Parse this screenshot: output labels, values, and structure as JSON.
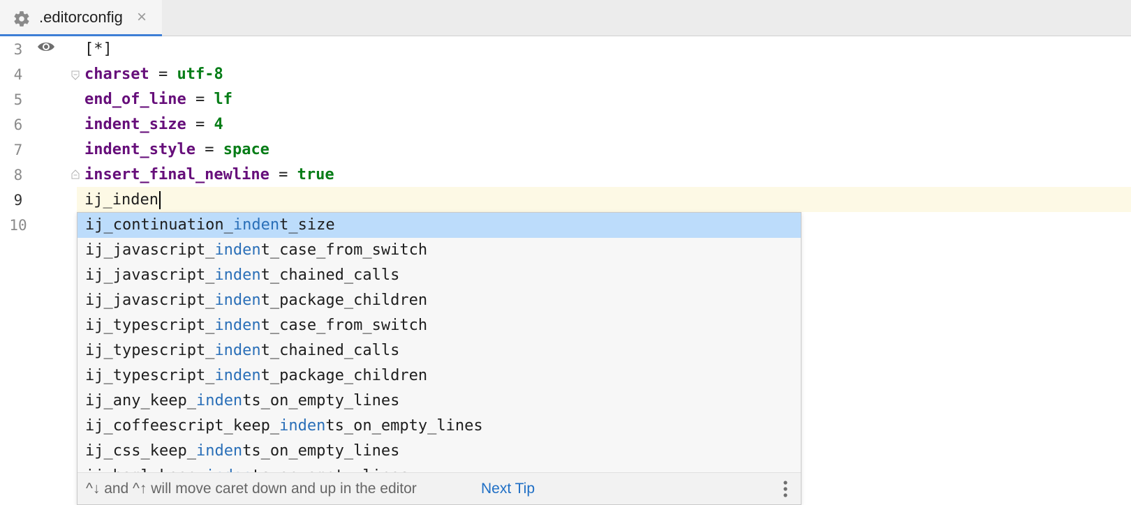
{
  "tab": {
    "title": ".editorconfig",
    "icon": "gear-icon",
    "close": "×"
  },
  "editor": {
    "lines": [
      {
        "num": "3",
        "plain": "[*]"
      },
      {
        "num": "4",
        "key": "charset",
        "sep": " = ",
        "value": "utf-8"
      },
      {
        "num": "5",
        "key": "end_of_line",
        "sep": " = ",
        "value": "lf"
      },
      {
        "num": "6",
        "key": "indent_size",
        "sep": " = ",
        "value": "4"
      },
      {
        "num": "7",
        "key": "indent_style",
        "sep": " = ",
        "value": "space"
      },
      {
        "num": "8",
        "key": "insert_final_newline",
        "sep": " = ",
        "value": "true"
      },
      {
        "num": "9",
        "plain": "ij_inden"
      },
      {
        "num": "10",
        "plain": ""
      }
    ]
  },
  "completion": {
    "items": [
      {
        "pre": "ij_continuation_",
        "match": "inden",
        "post": "t_size"
      },
      {
        "pre": "ij_javascript_",
        "match": "inden",
        "post": "t_case_from_switch"
      },
      {
        "pre": "ij_javascript_",
        "match": "inden",
        "post": "t_chained_calls"
      },
      {
        "pre": "ij_javascript_",
        "match": "inden",
        "post": "t_package_children"
      },
      {
        "pre": "ij_typescript_",
        "match": "inden",
        "post": "t_case_from_switch"
      },
      {
        "pre": "ij_typescript_",
        "match": "inden",
        "post": "t_chained_calls"
      },
      {
        "pre": "ij_typescript_",
        "match": "inden",
        "post": "t_package_children"
      },
      {
        "pre": "ij_any_keep_",
        "match": "inden",
        "post": "ts_on_empty_lines"
      },
      {
        "pre": "ij_coffeescript_keep_",
        "match": "inden",
        "post": "ts_on_empty_lines"
      },
      {
        "pre": "ij_css_keep_",
        "match": "inden",
        "post": "ts_on_empty_lines"
      },
      {
        "pre": "ij_haml_keep_",
        "match": "inden",
        "post": "ts_on_empty_lines"
      }
    ],
    "selected_index": 0,
    "footer_hint": "^↓ and ^↑ will move caret down and up in the editor",
    "next_tip": "Next Tip"
  },
  "colors": {
    "accent": "#3d7ed6",
    "selection": "#bcdcfb",
    "match": "#2a6fb8",
    "keyword": "#660e7a",
    "value": "#067d17",
    "current_line": "#fdf9e5"
  }
}
